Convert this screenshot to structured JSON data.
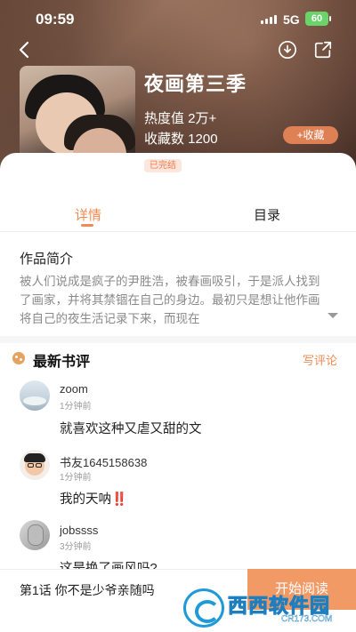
{
  "status_bar": {
    "time": "09:59",
    "network": "5G",
    "battery": "60"
  },
  "book": {
    "title": "夜画第三季",
    "heat": "热度值 2万+",
    "favorites": "收藏数 1200",
    "collect_label": "+收藏",
    "status_badge": "已完结"
  },
  "tabs": [
    {
      "label": "详情",
      "active": true
    },
    {
      "label": "目录",
      "active": false
    }
  ],
  "intro": {
    "heading": "作品简介",
    "text": "被人们说成是疯子的尹胜浩，被春画吸引，于是派人找到了画家，并将其禁锢在自己的身边。最初只是想让他作画将自己的夜生活记录下来，而现在"
  },
  "reviews": {
    "heading": "最新书评",
    "write_label": "写评论",
    "items": [
      {
        "user": "zoom",
        "time": "1分钟前",
        "text": "就喜欢这种又虐又甜的文"
      },
      {
        "user": "书友1645158638",
        "time": "1分钟前",
        "text": "我的天呐",
        "emphasis": "‼️"
      },
      {
        "user": "jobssss",
        "time": "3分钟前",
        "text": "这是换了画风吗?"
      }
    ]
  },
  "bottom": {
    "chapter": "第1话 你不是少爷亲随吗",
    "read_label": "开始阅读"
  },
  "watermark": {
    "text": "西西软件园",
    "url": "CR173.COM"
  },
  "icons": {
    "back": "back-arrow-icon",
    "download": "download-icon",
    "share": "share-icon",
    "expand": "chevron-down-icon"
  },
  "colors": {
    "accent": "#f08a52",
    "read_button": "#f19a66",
    "badge_bg": "#fde6dc"
  }
}
